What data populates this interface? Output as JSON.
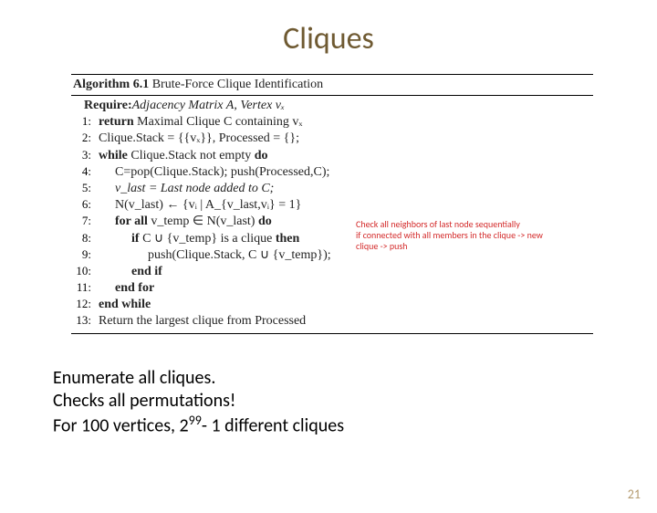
{
  "title": "Cliques",
  "algorithm": {
    "heading_prefix": "Algorithm 6.1",
    "heading_text": " Brute-Force Clique Identification",
    "require_label": "Require:",
    "require_text": " Adjacency Matrix A, Vertex vₓ",
    "lines": [
      {
        "num": "1:",
        "indent": 0,
        "bold": "return",
        "rest": "  Maximal Clique C containing vₓ"
      },
      {
        "num": "2:",
        "indent": 0,
        "bold": "",
        "rest": "Clique.Stack = {{vₓ}}, Processed = {};"
      },
      {
        "num": "3:",
        "indent": 0,
        "bold": "while",
        "rest": " Clique.Stack not empty ",
        "tail_bold": "do"
      },
      {
        "num": "4:",
        "indent": 1,
        "bold": "",
        "rest": "C=pop(Clique.Stack); push(Processed,C);"
      },
      {
        "num": "5:",
        "indent": 1,
        "bold": "",
        "rest": "v_last = Last node added to C;",
        "ital": true
      },
      {
        "num": "6:",
        "indent": 1,
        "bold": "",
        "rest": "N(v_last) ← {vᵢ | A_{v_last,vᵢ} = 1}"
      },
      {
        "num": "7:",
        "indent": 1,
        "bold": "for all",
        "rest": " v_temp ∈ N(v_last) ",
        "tail_bold": "do"
      },
      {
        "num": "8:",
        "indent": 2,
        "bold": "if",
        "rest": " C ∪ {v_temp} is a clique ",
        "tail_bold": "then"
      },
      {
        "num": "9:",
        "indent": 3,
        "bold": "",
        "rest": "push(Clique.Stack, C ∪ {v_temp});"
      },
      {
        "num": "10:",
        "indent": 2,
        "bold": "end if",
        "rest": ""
      },
      {
        "num": "11:",
        "indent": 1,
        "bold": "end for",
        "rest": ""
      },
      {
        "num": "12:",
        "indent": 0,
        "bold": "end while",
        "rest": ""
      },
      {
        "num": "13:",
        "indent": 0,
        "bold": "",
        "rest": "Return the largest clique from Processed"
      }
    ]
  },
  "annotation": {
    "line1": "Check all neighbors of last node sequentially",
    "line2": "  if connected with all members in the clique -> new",
    "line3": "clique -> push"
  },
  "summary": {
    "line1": "Enumerate all cliques.",
    "line2": "Checks all permutations!",
    "line3_a": "For 100 vertices, 2",
    "line3_sup": "99",
    "line3_b": "- 1 different cliques"
  },
  "pagenum": "21"
}
